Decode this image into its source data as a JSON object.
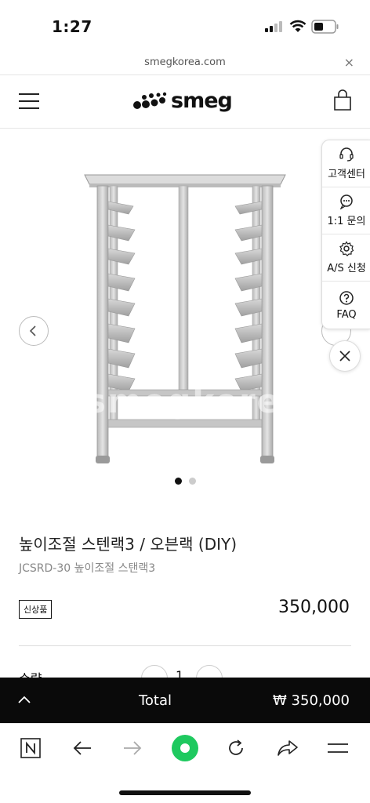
{
  "status_bar": {
    "time": "1:27"
  },
  "browser": {
    "url": "smegkorea.com",
    "close_label": "×"
  },
  "header": {
    "logo_text": "smeg"
  },
  "gallery": {
    "watermark": "smegkorea",
    "active_index": 0,
    "total": 2
  },
  "side_panel": {
    "items": [
      {
        "label": "고객센터",
        "icon": "headset-icon"
      },
      {
        "label": "1:1 문의",
        "icon": "chat-icon"
      },
      {
        "label": "A/S 신청",
        "icon": "gear-icon"
      },
      {
        "label": "FAQ",
        "icon": "question-icon"
      }
    ]
  },
  "product": {
    "title": "높이조절 스텐랙3 / 오븐랙 (DIY)",
    "subtitle": "JCSRD-30 높이조절 스탠랙3",
    "badge": "신상품",
    "price": "350,000",
    "quantity_label": "수량",
    "quantity": "1"
  },
  "total_bar": {
    "label": "Total",
    "value": "₩ 350,000"
  },
  "colors": {
    "total_bar_bg": "#0a0a0a",
    "accent_green": "#1ec95f"
  }
}
